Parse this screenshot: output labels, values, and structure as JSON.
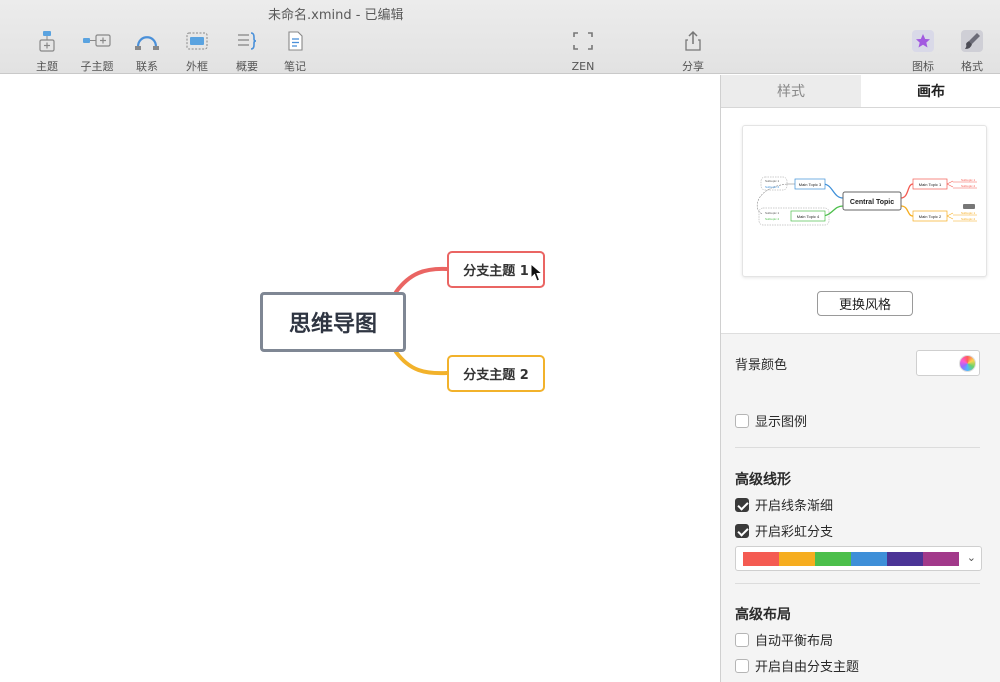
{
  "window": {
    "title": "未命名.xmind - 已编辑"
  },
  "toolbar": {
    "topic": "主题",
    "subtopic": "子主题",
    "relationship": "联系",
    "boundary": "外框",
    "summary": "概要",
    "notes": "笔记",
    "zen": "ZEN",
    "share": "分享",
    "icons": "图标",
    "format": "格式"
  },
  "map": {
    "central_topic": "思维导图",
    "branches": [
      {
        "label": "分支主题 1",
        "color": "#ea6563"
      },
      {
        "label": "分支主题 2",
        "color": "#f2b22b"
      }
    ]
  },
  "panel": {
    "tabs": [
      {
        "label": "样式",
        "active": false
      },
      {
        "label": "画布",
        "active": true
      }
    ],
    "thumbnail": {
      "central": "Central Topic",
      "topics": [
        "Main Topic 1",
        "Main Topic 2",
        "Main Topic 3",
        "Main Topic 4"
      ],
      "subtopics": [
        "Subtopic 1",
        "Subtopic 2"
      ]
    },
    "change_style_button": "更换风格",
    "background_color_label": "背景颜色",
    "show_legend": {
      "label": "显示图例",
      "checked": false
    },
    "advanced_line": {
      "title": "高级线形",
      "taper": {
        "label": "开启线条渐细",
        "checked": true
      },
      "rainbow": {
        "label": "开启彩虹分支",
        "checked": true
      },
      "palette": [
        "#f45b52",
        "#f6ad1f",
        "#4cbf4b",
        "#3e8fd8",
        "#4b3496",
        "#a2398a"
      ]
    },
    "advanced_layout": {
      "title": "高级布局",
      "auto_balance": {
        "label": "自动平衡布局",
        "checked": false
      },
      "free_subtopic": {
        "label": "开启自由分支主题",
        "checked": false
      }
    }
  }
}
